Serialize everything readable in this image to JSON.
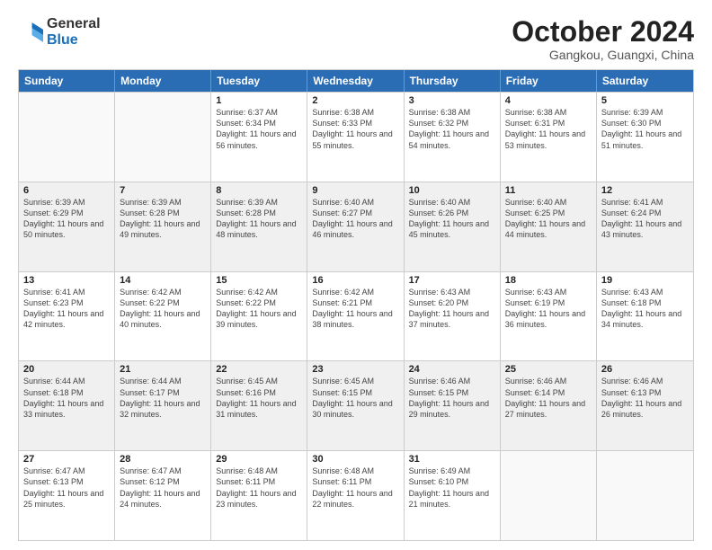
{
  "logo": {
    "general": "General",
    "blue": "Blue"
  },
  "title": "October 2024",
  "location": "Gangkou, Guangxi, China",
  "header_days": [
    "Sunday",
    "Monday",
    "Tuesday",
    "Wednesday",
    "Thursday",
    "Friday",
    "Saturday"
  ],
  "weeks": [
    [
      {
        "day": "",
        "info": "",
        "empty": true
      },
      {
        "day": "",
        "info": "",
        "empty": true
      },
      {
        "day": "1",
        "info": "Sunrise: 6:37 AM\nSunset: 6:34 PM\nDaylight: 11 hours and 56 minutes."
      },
      {
        "day": "2",
        "info": "Sunrise: 6:38 AM\nSunset: 6:33 PM\nDaylight: 11 hours and 55 minutes."
      },
      {
        "day": "3",
        "info": "Sunrise: 6:38 AM\nSunset: 6:32 PM\nDaylight: 11 hours and 54 minutes."
      },
      {
        "day": "4",
        "info": "Sunrise: 6:38 AM\nSunset: 6:31 PM\nDaylight: 11 hours and 53 minutes."
      },
      {
        "day": "5",
        "info": "Sunrise: 6:39 AM\nSunset: 6:30 PM\nDaylight: 11 hours and 51 minutes."
      }
    ],
    [
      {
        "day": "6",
        "info": "Sunrise: 6:39 AM\nSunset: 6:29 PM\nDaylight: 11 hours and 50 minutes.",
        "shaded": true
      },
      {
        "day": "7",
        "info": "Sunrise: 6:39 AM\nSunset: 6:28 PM\nDaylight: 11 hours and 49 minutes.",
        "shaded": true
      },
      {
        "day": "8",
        "info": "Sunrise: 6:39 AM\nSunset: 6:28 PM\nDaylight: 11 hours and 48 minutes.",
        "shaded": true
      },
      {
        "day": "9",
        "info": "Sunrise: 6:40 AM\nSunset: 6:27 PM\nDaylight: 11 hours and 46 minutes.",
        "shaded": true
      },
      {
        "day": "10",
        "info": "Sunrise: 6:40 AM\nSunset: 6:26 PM\nDaylight: 11 hours and 45 minutes.",
        "shaded": true
      },
      {
        "day": "11",
        "info": "Sunrise: 6:40 AM\nSunset: 6:25 PM\nDaylight: 11 hours and 44 minutes.",
        "shaded": true
      },
      {
        "day": "12",
        "info": "Sunrise: 6:41 AM\nSunset: 6:24 PM\nDaylight: 11 hours and 43 minutes.",
        "shaded": true
      }
    ],
    [
      {
        "day": "13",
        "info": "Sunrise: 6:41 AM\nSunset: 6:23 PM\nDaylight: 11 hours and 42 minutes."
      },
      {
        "day": "14",
        "info": "Sunrise: 6:42 AM\nSunset: 6:22 PM\nDaylight: 11 hours and 40 minutes."
      },
      {
        "day": "15",
        "info": "Sunrise: 6:42 AM\nSunset: 6:22 PM\nDaylight: 11 hours and 39 minutes."
      },
      {
        "day": "16",
        "info": "Sunrise: 6:42 AM\nSunset: 6:21 PM\nDaylight: 11 hours and 38 minutes."
      },
      {
        "day": "17",
        "info": "Sunrise: 6:43 AM\nSunset: 6:20 PM\nDaylight: 11 hours and 37 minutes."
      },
      {
        "day": "18",
        "info": "Sunrise: 6:43 AM\nSunset: 6:19 PM\nDaylight: 11 hours and 36 minutes."
      },
      {
        "day": "19",
        "info": "Sunrise: 6:43 AM\nSunset: 6:18 PM\nDaylight: 11 hours and 34 minutes."
      }
    ],
    [
      {
        "day": "20",
        "info": "Sunrise: 6:44 AM\nSunset: 6:18 PM\nDaylight: 11 hours and 33 minutes.",
        "shaded": true
      },
      {
        "day": "21",
        "info": "Sunrise: 6:44 AM\nSunset: 6:17 PM\nDaylight: 11 hours and 32 minutes.",
        "shaded": true
      },
      {
        "day": "22",
        "info": "Sunrise: 6:45 AM\nSunset: 6:16 PM\nDaylight: 11 hours and 31 minutes.",
        "shaded": true
      },
      {
        "day": "23",
        "info": "Sunrise: 6:45 AM\nSunset: 6:15 PM\nDaylight: 11 hours and 30 minutes.",
        "shaded": true
      },
      {
        "day": "24",
        "info": "Sunrise: 6:46 AM\nSunset: 6:15 PM\nDaylight: 11 hours and 29 minutes.",
        "shaded": true
      },
      {
        "day": "25",
        "info": "Sunrise: 6:46 AM\nSunset: 6:14 PM\nDaylight: 11 hours and 27 minutes.",
        "shaded": true
      },
      {
        "day": "26",
        "info": "Sunrise: 6:46 AM\nSunset: 6:13 PM\nDaylight: 11 hours and 26 minutes.",
        "shaded": true
      }
    ],
    [
      {
        "day": "27",
        "info": "Sunrise: 6:47 AM\nSunset: 6:13 PM\nDaylight: 11 hours and 25 minutes."
      },
      {
        "day": "28",
        "info": "Sunrise: 6:47 AM\nSunset: 6:12 PM\nDaylight: 11 hours and 24 minutes."
      },
      {
        "day": "29",
        "info": "Sunrise: 6:48 AM\nSunset: 6:11 PM\nDaylight: 11 hours and 23 minutes."
      },
      {
        "day": "30",
        "info": "Sunrise: 6:48 AM\nSunset: 6:11 PM\nDaylight: 11 hours and 22 minutes."
      },
      {
        "day": "31",
        "info": "Sunrise: 6:49 AM\nSunset: 6:10 PM\nDaylight: 11 hours and 21 minutes."
      },
      {
        "day": "",
        "info": "",
        "empty": true
      },
      {
        "day": "",
        "info": "",
        "empty": true
      }
    ]
  ]
}
